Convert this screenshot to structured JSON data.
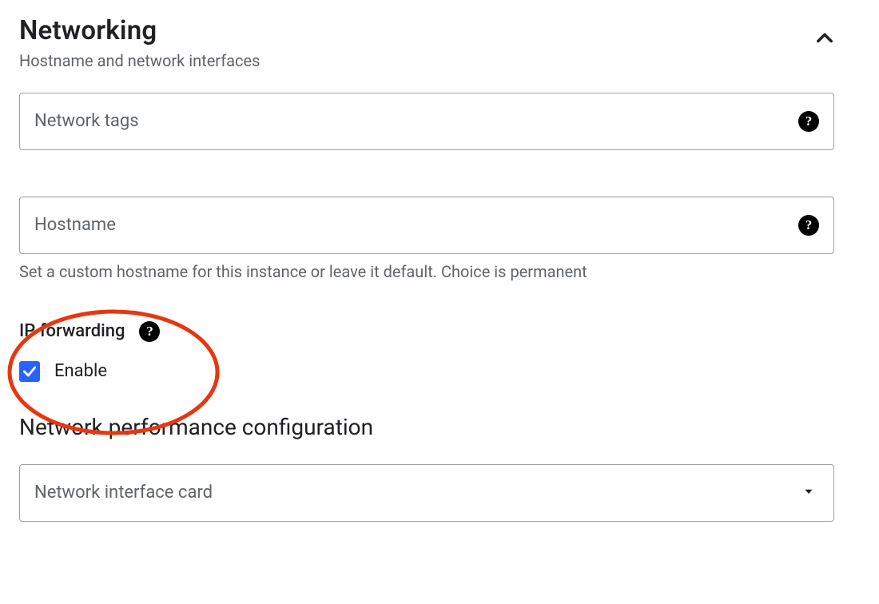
{
  "section": {
    "title": "Networking",
    "subtitle": "Hostname and network interfaces"
  },
  "networkTags": {
    "placeholder": "Network tags"
  },
  "hostname": {
    "placeholder": "Hostname",
    "helper": "Set a custom hostname for this instance or leave it default. Choice is permanent"
  },
  "ipForwarding": {
    "label": "IP forwarding",
    "checkboxLabel": "Enable",
    "checked": true
  },
  "networkPerformance": {
    "title": "Network performance configuration"
  },
  "networkInterfaceCard": {
    "placeholder": "Network interface card"
  },
  "colors": {
    "accent": "#2962ff",
    "annotation": "#e8360f"
  }
}
